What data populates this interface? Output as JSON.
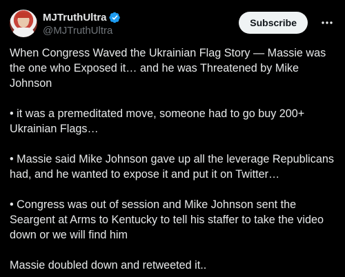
{
  "author": {
    "display_name": "MJTruthUltra",
    "handle": "@MJTruthUltra",
    "verified_icon": "verified-badge-icon",
    "verified_color": "#1d9bf0"
  },
  "actions": {
    "subscribe_label": "Subscribe",
    "more_icon": "more-options-icon"
  },
  "tweet": {
    "paragraphs": [
      "When Congress Waved the Ukrainian Flag Story — Massie was the one who Exposed it… and he was Threatened by Mike Johnson",
      "• it was a premeditated move, someone had to go buy 200+ Ukrainian Flags…",
      "• Massie said Mike Johnson gave up all the leverage Republicans had, and he wanted to expose it and put it on Twitter…",
      "• Congress was out of session and Mike Johnson sent the Seargent at Arms to Kentucky to tell his staffer to take the video down or we will find him",
      "Massie doubled down and retweeted it.."
    ]
  },
  "colors": {
    "background": "#000000",
    "text": "#e7e9ea",
    "secondary_text": "#71767b",
    "button_bg": "#eff3f4"
  }
}
